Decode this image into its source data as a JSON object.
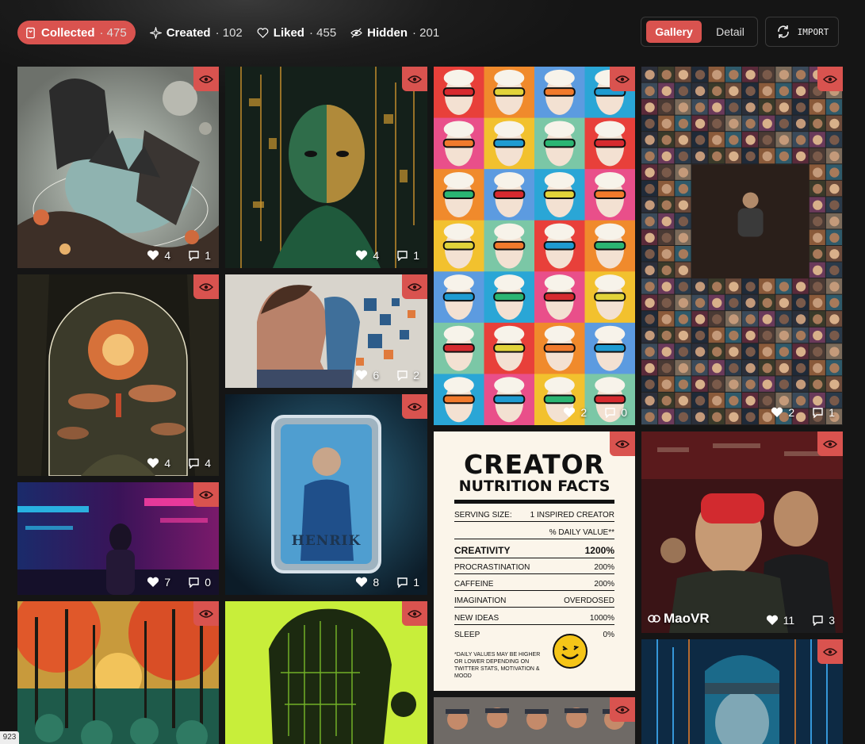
{
  "filters": {
    "collected": {
      "label": "Collected",
      "count": "· 475"
    },
    "created": {
      "label": "Created",
      "count": "· 102"
    },
    "liked": {
      "label": "Liked",
      "count": "· 455"
    },
    "hidden": {
      "label": "Hidden",
      "count": "· 201"
    }
  },
  "view": {
    "gallery": "Gallery",
    "detail": "Detail"
  },
  "import_label": "IMPORT",
  "cards": [
    {
      "likes": "4",
      "comments": "1"
    },
    {
      "likes": "4",
      "comments": "1"
    },
    {
      "likes": "2",
      "comments": "0"
    },
    {
      "likes": "2",
      "comments": "1"
    },
    {
      "likes": "4",
      "comments": "4"
    },
    {
      "likes": "6",
      "comments": "2"
    },
    {
      "likes": "7",
      "comments": "0"
    },
    {
      "likes": "8",
      "comments": "1"
    },
    {
      "likes": "11",
      "comments": "3",
      "author": "MaoVR"
    }
  ],
  "henrik_text": "HENRIK",
  "nutrition": {
    "title": "CREATOR",
    "subtitle": "NUTRITION FACTS",
    "serving_label": "SERVING SIZE:",
    "serving_value": "1 INSPIRED CREATOR",
    "daily_value": "% DAILY VALUE**",
    "rows": [
      {
        "label": "CREATIVITY",
        "value": "1200%"
      },
      {
        "label": "PROCRASTINATION",
        "value": "200%"
      },
      {
        "label": "CAFFEINE",
        "value": "200%"
      },
      {
        "label": "IMAGINATION",
        "value": "OVERDOSED"
      },
      {
        "label": "NEW IDEAS",
        "value": "1000%"
      },
      {
        "label": "SLEEP",
        "value": "0%"
      }
    ],
    "footnote": "*DAILY VALUES MAY BE HIGHER OR LOWER DEPENDING ON TWITTER STATS, MOTIVATION & MOOD"
  },
  "side_chip": "923",
  "colors": {
    "accent": "#d9534f",
    "background": "#141414"
  }
}
